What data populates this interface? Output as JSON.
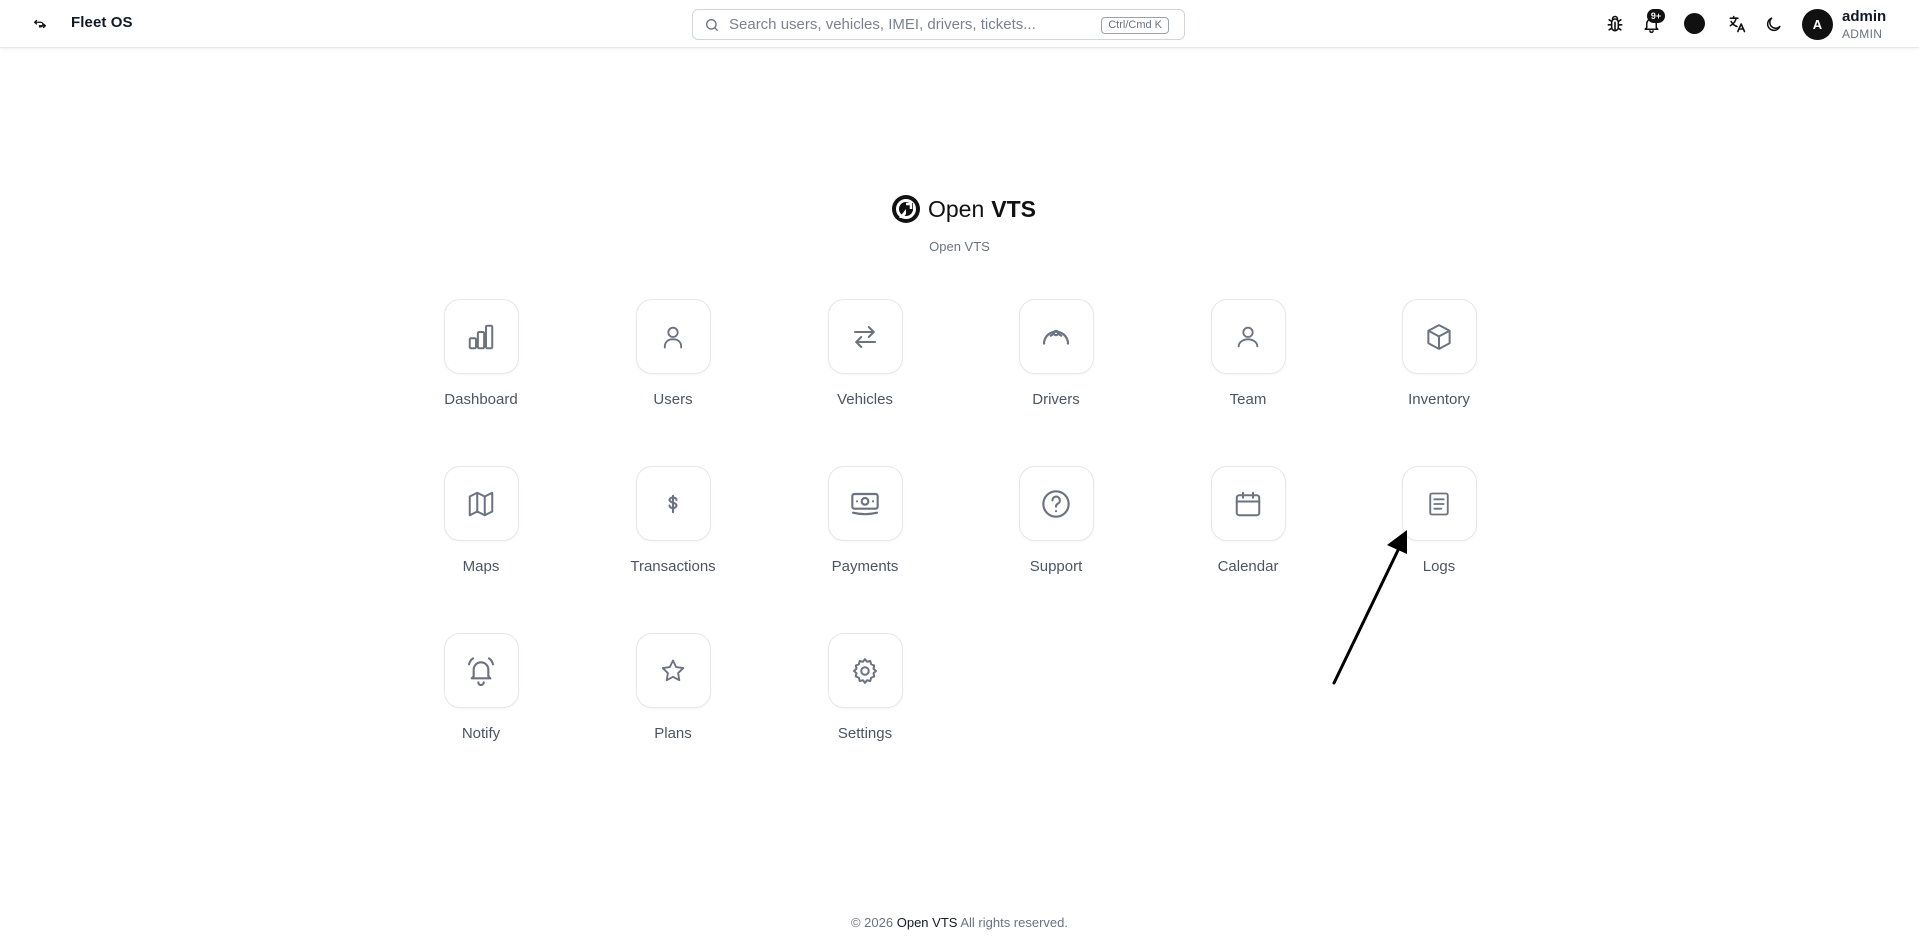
{
  "header": {
    "brand": "Fleet OS",
    "search_placeholder": "Search users, vehicles, IMEI, drivers, tickets...",
    "search_shortcut": "Ctrl/Cmd K",
    "notification_badge": "9+",
    "user": {
      "avatar_initial": "A",
      "name": "admin",
      "role": "ADMIN"
    },
    "icons": [
      "sidebar-toggle-icon",
      "search-icon",
      "bug-icon",
      "bell-icon",
      "theme-color-icon",
      "translate-icon",
      "moon-icon"
    ]
  },
  "logo": {
    "word1": "Open",
    "word2": "VTS",
    "subtitle": "Open VTS"
  },
  "apps": [
    {
      "label": "Dashboard",
      "icon": "bar-chart-icon"
    },
    {
      "label": "Users",
      "icon": "user-icon"
    },
    {
      "label": "Vehicles",
      "icon": "arrows-swap-icon"
    },
    {
      "label": "Drivers",
      "icon": "steering-icon"
    },
    {
      "label": "Team",
      "icon": "team-icon"
    },
    {
      "label": "Inventory",
      "icon": "box-icon"
    },
    {
      "label": "Maps",
      "icon": "map-icon"
    },
    {
      "label": "Transactions",
      "icon": "dollar-icon"
    },
    {
      "label": "Payments",
      "icon": "banknote-icon"
    },
    {
      "label": "Support",
      "icon": "help-circle-icon"
    },
    {
      "label": "Calendar",
      "icon": "calendar-icon"
    },
    {
      "label": "Logs",
      "icon": "document-icon"
    },
    {
      "label": "Notify",
      "icon": "alarm-bell-icon"
    },
    {
      "label": "Plans",
      "icon": "star-icon"
    },
    {
      "label": "Settings",
      "icon": "gear-icon"
    }
  ],
  "footer": {
    "copyright": "© 2026",
    "company": "Open VTS",
    "rights": "All rights reserved."
  },
  "colors": {
    "text": "#111827",
    "muted": "#6b7280",
    "tile_border": "#e5e7eb",
    "icon_stroke": "#6b7280"
  }
}
